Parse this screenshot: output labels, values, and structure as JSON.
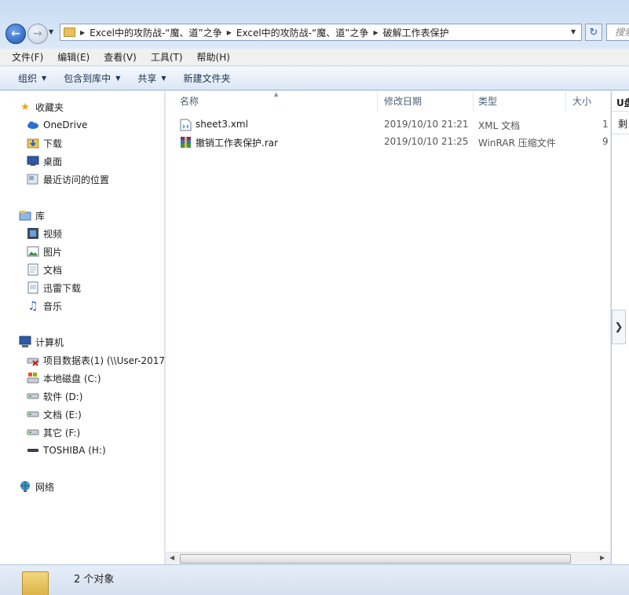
{
  "address": {
    "crumbs": [
      "Excel中的攻防战-“魔、道”之争",
      "Excel中的攻防战-“魔、道”之争",
      "破解工作表保护"
    ],
    "search_placeholder": "搜索"
  },
  "menu": [
    "文件(F)",
    "编辑(E)",
    "查看(V)",
    "工具(T)",
    "帮助(H)"
  ],
  "commands": {
    "organize": "组织",
    "include_library": "包含到库中",
    "share": "共享",
    "new_folder": "新建文件夹"
  },
  "nav": {
    "favorites": {
      "label": "收藏夹",
      "items": [
        "OneDrive",
        "下载",
        "桌面",
        "最近访问的位置"
      ]
    },
    "libraries": {
      "label": "库",
      "items": [
        "视频",
        "图片",
        "文档",
        "迅雷下载",
        "音乐"
      ]
    },
    "computer": {
      "label": "计算机",
      "items": [
        "项目数据表(1) (\\\\User-2017",
        "本地磁盘 (C:)",
        "软件 (D:)",
        "文档 (E:)",
        "其它 (F:)",
        "TOSHIBA (H:)"
      ]
    },
    "network": {
      "label": "网络"
    }
  },
  "columns": {
    "name": "名称",
    "modified": "修改日期",
    "type": "类型",
    "size": "大小"
  },
  "files": [
    {
      "name": "sheet3.xml",
      "modified": "2019/10/10 21:21",
      "type": "XML 文档",
      "size": "1"
    },
    {
      "name": "撤销工作表保护.rar",
      "modified": "2019/10/10 21:25",
      "type": "WinRAR 压缩文件",
      "size": "9"
    }
  ],
  "preview": {
    "header": "U盘",
    "row": "剩"
  },
  "status": {
    "count": "2 个对象"
  },
  "icons": {
    "back": "back-arrow-icon",
    "forward": "forward-arrow-icon",
    "refresh": "refresh-icon",
    "xml": "xml-document-icon",
    "rar": "winrar-archive-icon"
  }
}
